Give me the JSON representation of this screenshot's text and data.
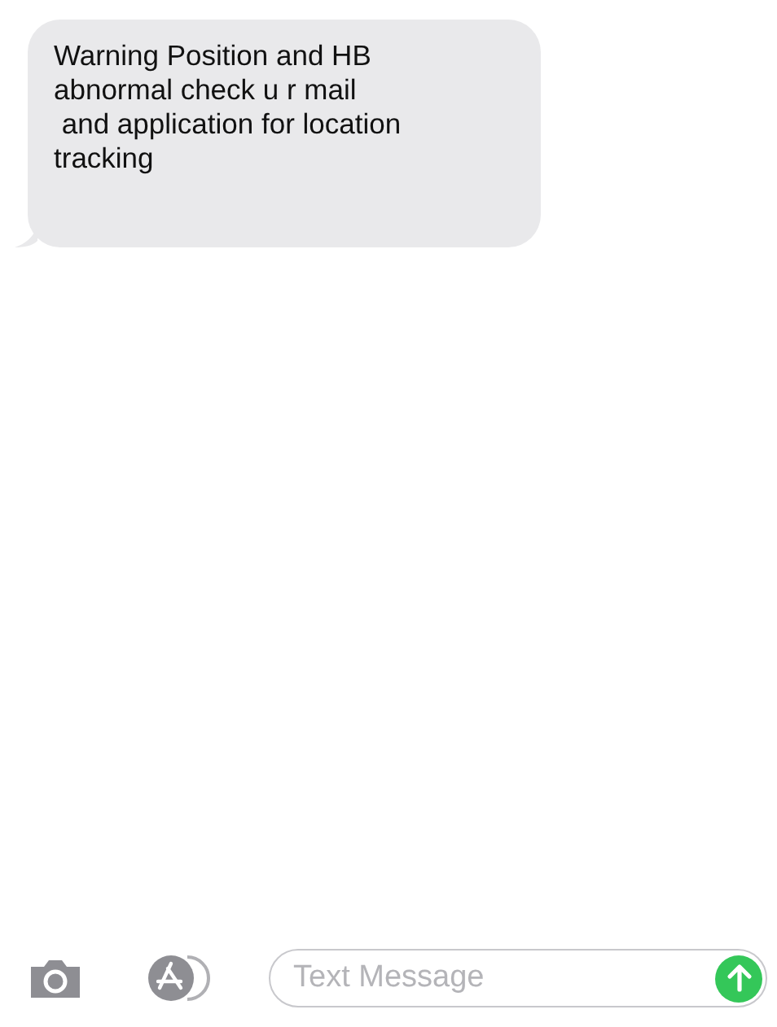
{
  "messages": [
    {
      "text": "Warning Position and HB\nabnormal check u r mail\n and application for location\ntracking"
    }
  ],
  "composer": {
    "placeholder": "Text Message"
  }
}
